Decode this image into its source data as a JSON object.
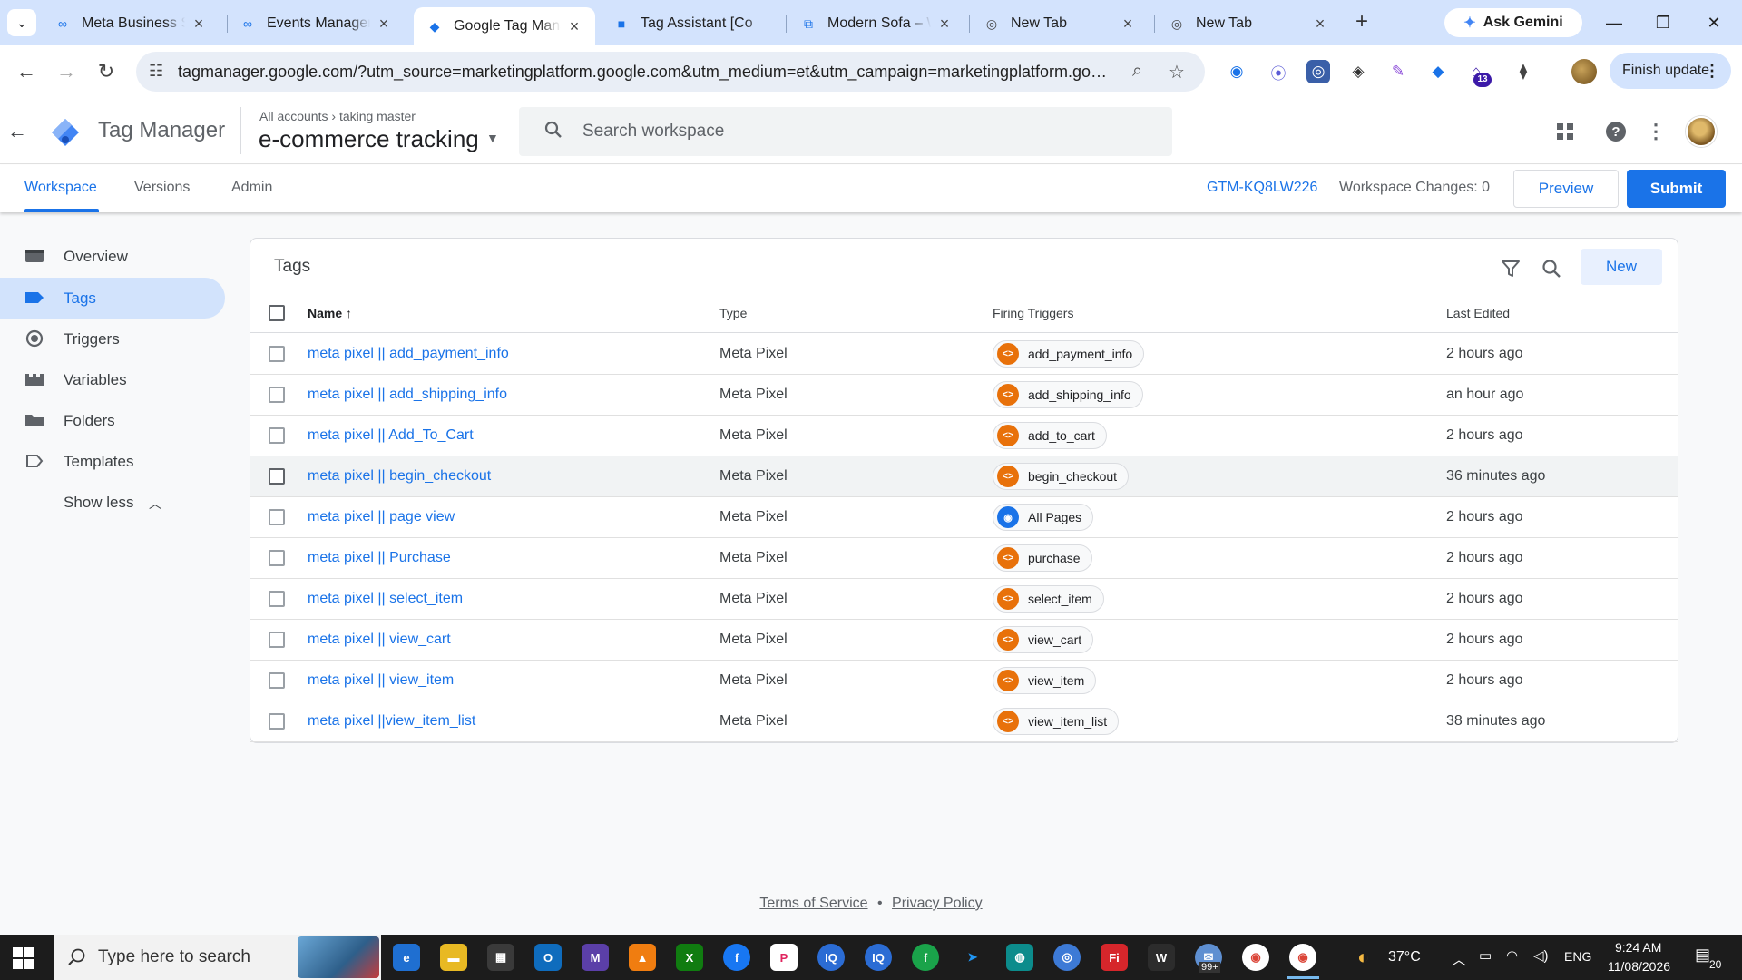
{
  "browser": {
    "tabs": [
      {
        "title": "Meta Business Su",
        "icon": "meta-icon",
        "active": false
      },
      {
        "title": "Events Manager",
        "icon": "meta-icon",
        "active": false
      },
      {
        "title": "Google Tag Mana",
        "icon": "gtm-icon",
        "active": true
      },
      {
        "title": "Tag Assistant [Co",
        "icon": "tag-assistant-icon",
        "active": false
      },
      {
        "title": "Modern Sofa – W",
        "icon": "site-icon",
        "active": false
      },
      {
        "title": "New Tab",
        "icon": "chrome-icon",
        "active": false
      },
      {
        "title": "New Tab",
        "icon": "chrome-icon",
        "active": false
      }
    ],
    "ask_gemini": "Ask Gemini",
    "url": "tagmanager.google.com/?utm_source=marketingplatform.google.com&utm_medium=et&utm_campaign=marketingplatform.googl...",
    "extension_badge": "13",
    "finish_update": "Finish update"
  },
  "gtm": {
    "product_name": "Tag Manager",
    "breadcrumb_all": "All accounts",
    "breadcrumb_account": "taking master",
    "container_name": "e-commerce tracking",
    "search_placeholder": "Search workspace",
    "nav_tabs": [
      "Workspace",
      "Versions",
      "Admin"
    ],
    "container_id": "GTM-KQ8LW226",
    "workspace_changes": "Workspace Changes: 0",
    "preview_label": "Preview",
    "submit_label": "Submit"
  },
  "sidebar": {
    "items": [
      {
        "label": "Overview",
        "icon": "overview-icon"
      },
      {
        "label": "Tags",
        "icon": "tag-icon"
      },
      {
        "label": "Triggers",
        "icon": "trigger-icon"
      },
      {
        "label": "Variables",
        "icon": "variables-icon"
      },
      {
        "label": "Folders",
        "icon": "folder-icon"
      },
      {
        "label": "Templates",
        "icon": "template-icon"
      }
    ],
    "show_less": "Show less"
  },
  "tags": {
    "title": "Tags",
    "new_label": "New",
    "columns": [
      "Name",
      "Type",
      "Firing Triggers",
      "Last Edited"
    ],
    "rows": [
      {
        "name": "meta pixel || add_payment_info",
        "type": "Meta Pixel",
        "trigger": "add_payment_info",
        "trigger_kind": "custom",
        "edited": "2 hours ago"
      },
      {
        "name": "meta pixel || add_shipping_info",
        "type": "Meta Pixel",
        "trigger": "add_shipping_info",
        "trigger_kind": "custom",
        "edited": "an hour ago"
      },
      {
        "name": "meta pixel || Add_To_Cart",
        "type": "Meta Pixel",
        "trigger": "add_to_cart",
        "trigger_kind": "custom",
        "edited": "2 hours ago"
      },
      {
        "name": "meta pixel || begin_checkout",
        "type": "Meta Pixel",
        "trigger": "begin_checkout",
        "trigger_kind": "custom",
        "edited": "36 minutes ago"
      },
      {
        "name": "meta pixel || page view",
        "type": "Meta Pixel",
        "trigger": "All Pages",
        "trigger_kind": "pageview",
        "edited": "2 hours ago"
      },
      {
        "name": "meta pixel || Purchase",
        "type": "Meta Pixel",
        "trigger": "purchase",
        "trigger_kind": "custom",
        "edited": "2 hours ago"
      },
      {
        "name": "meta pixel || select_item",
        "type": "Meta Pixel",
        "trigger": "select_item",
        "trigger_kind": "custom",
        "edited": "2 hours ago"
      },
      {
        "name": "meta pixel || view_cart",
        "type": "Meta Pixel",
        "trigger": "view_cart",
        "trigger_kind": "custom",
        "edited": "2 hours ago"
      },
      {
        "name": "meta pixel || view_item",
        "type": "Meta Pixel",
        "trigger": "view_item",
        "trigger_kind": "custom",
        "edited": "2 hours ago"
      },
      {
        "name": "meta pixel ||view_item_list",
        "type": "Meta Pixel",
        "trigger": "view_item_list",
        "trigger_kind": "custom",
        "edited": "38 minutes ago"
      }
    ]
  },
  "footer": {
    "terms": "Terms of Service",
    "separator": "•",
    "privacy": "Privacy Policy"
  },
  "taskbar": {
    "search_placeholder": "Type here to search",
    "temperature": "37°C",
    "language": "ENG",
    "time": "9:24 AM",
    "date": "11/08/2026",
    "notification_count": "20",
    "chrome_badge": "99+"
  },
  "colors": {
    "accent": "#1a73e8",
    "trigger_custom": "#e8710a",
    "sidebar_active": "#d2e3fc"
  }
}
